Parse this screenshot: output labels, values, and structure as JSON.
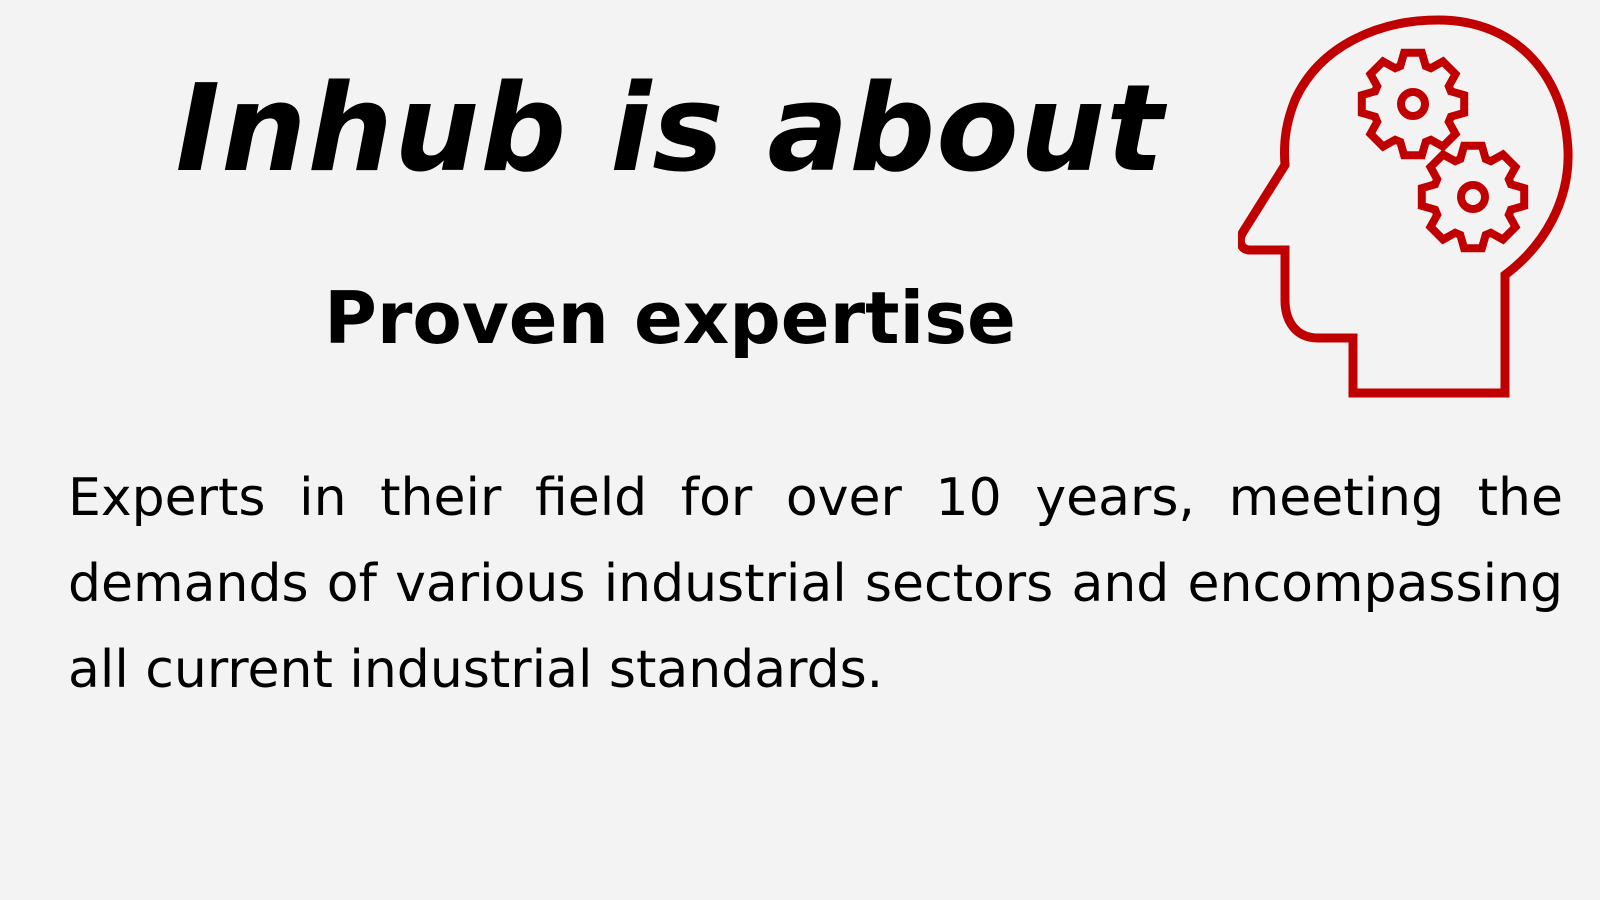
{
  "slide": {
    "background_color": "#f3f3f3",
    "accent_color": "#c00000",
    "headline": "Inhub is about",
    "subheadline": "Proven expertise",
    "body": "Experts in their field for over 10 years, meeting the demands of various industrial sectors and encompassing all current industrial standards.",
    "icon": "head-with-gears-icon"
  }
}
